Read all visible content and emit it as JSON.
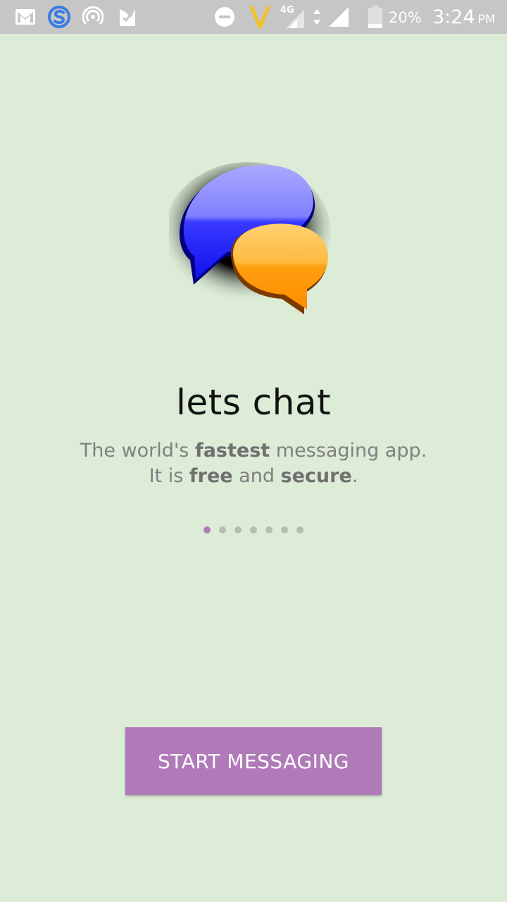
{
  "status_bar": {
    "icons": [
      "gmail-icon",
      "skype-icon",
      "hotspot-icon",
      "check-app-icon",
      "do-not-disturb-icon",
      "vodafone-v-icon",
      "signal-4g-icon",
      "data-arrows-icon",
      "signal-icon",
      "battery-icon"
    ],
    "network_label": "4G",
    "battery_percent": "20%",
    "time": "3:24",
    "ampm": "PM",
    "battery_level": 0.2
  },
  "onboarding": {
    "title": "lets chat",
    "tagline_line1": {
      "pre": "The world's ",
      "bold": "fastest",
      "post": " messaging app."
    },
    "tagline_line2": {
      "pre": "It is ",
      "bold1": "free",
      "mid": " and ",
      "bold2": "secure",
      "post": "."
    },
    "page_count": 7,
    "current_page": 1,
    "start_button_label": "START MESSAGING"
  },
  "colors": {
    "background": "#dcecd6",
    "status_bar": "#c6c6c6",
    "accent": "#b07ab8",
    "blue_bubble": "#3333ff",
    "orange_bubble": "#ffa500"
  }
}
